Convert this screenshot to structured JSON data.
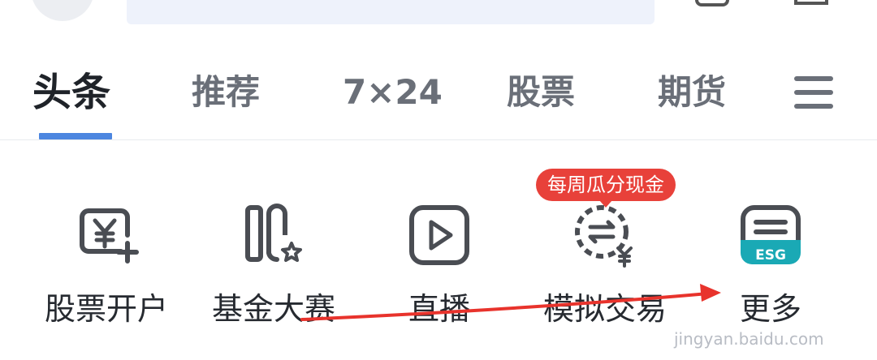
{
  "tabs": [
    {
      "label": "头条",
      "active": true
    },
    {
      "label": "推荐",
      "active": false
    },
    {
      "label": "7×24",
      "active": false
    },
    {
      "label": "股票",
      "active": false
    },
    {
      "label": "期货",
      "active": false
    }
  ],
  "entries": [
    {
      "label": "股票开户",
      "icon": "yen-plus-icon"
    },
    {
      "label": "基金大赛",
      "icon": "fund-contest-icon"
    },
    {
      "label": "直播",
      "icon": "play-icon"
    },
    {
      "label": "模拟交易",
      "icon": "simulated-trade-icon"
    },
    {
      "label": "更多",
      "icon": "esg-more-icon"
    }
  ],
  "promo_badge": "每周瓜分现金",
  "esg_text": "ESG",
  "watermark": {
    "url": "jingyan.baidu.com"
  },
  "colors": {
    "accent": "#4c86e0",
    "badge": "#e8413a",
    "esg": "#1aa9b5",
    "annotation_arrow": "#e8332c"
  }
}
